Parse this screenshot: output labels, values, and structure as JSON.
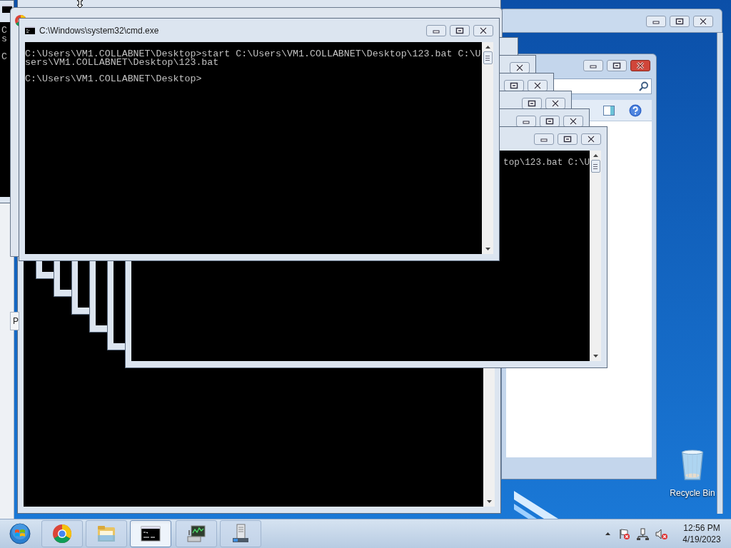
{
  "desktop": {
    "icons": [
      {
        "label": "Recycle Bin"
      }
    ]
  },
  "left_console": {
    "lines": [
      "C",
      "s"
    ],
    "prompt": "C"
  },
  "side_panel": {
    "text": "P"
  },
  "cascade_windows": [
    {
      "kind": "cmd"
    },
    {
      "kind": "cmd"
    },
    {
      "kind": "cmd"
    },
    {
      "kind": "cmd"
    },
    {
      "kind": "cmd"
    },
    {
      "kind": "cmd",
      "lines": [
        "top\\123.bat C:\\U"
      ]
    }
  ],
  "front_window": {
    "title": "C:\\Windows\\system32\\cmd.exe",
    "lines": [
      "C:\\Users\\VM1.COLLABNET\\Desktop>start C:\\Users\\VM1.COLLABNET\\Desktop\\123.bat C:\\U",
      "sers\\VM1.COLLABNET\\Desktop\\123.bat"
    ],
    "prompt": "C:\\Users\\VM1.COLLABNET\\Desktop>"
  },
  "taskbar": {
    "buttons": [
      {
        "kind": "chrome",
        "selected": false
      },
      {
        "kind": "explorer",
        "selected": false
      },
      {
        "kind": "cmd",
        "selected": true
      },
      {
        "kind": "monitor",
        "selected": false
      },
      {
        "kind": "server",
        "selected": false
      }
    ],
    "clock": {
      "time": "12:56 PM",
      "date": "4/19/2023"
    }
  }
}
